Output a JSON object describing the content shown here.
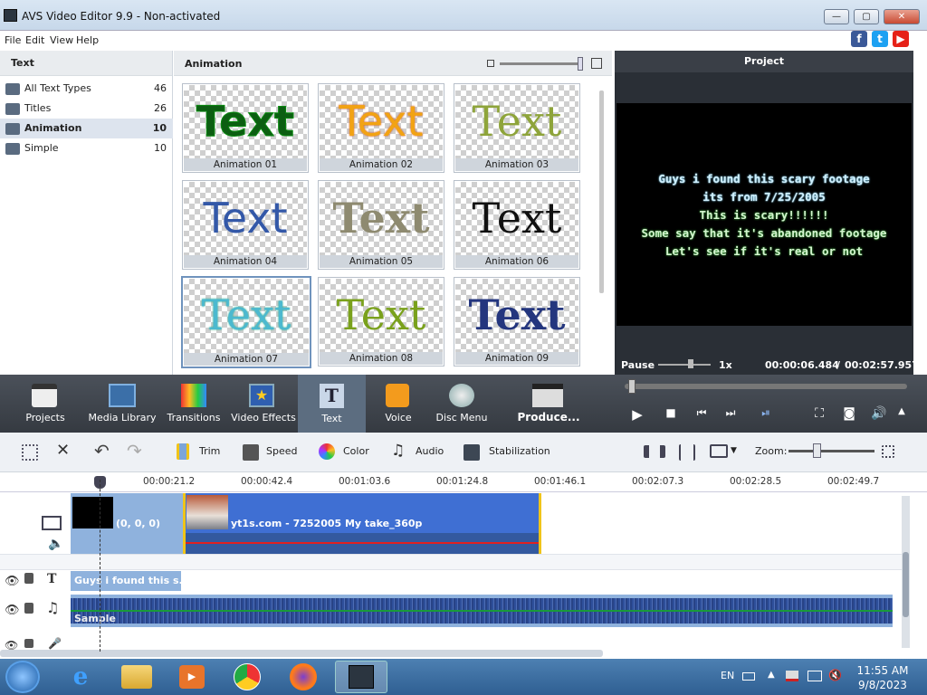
{
  "window": {
    "title": "AVS Video Editor 9.9 - Non-activated",
    "minimize": "—",
    "maximize": "▢",
    "close": "✕"
  },
  "menu": [
    "File",
    "Edit",
    "View",
    "Help"
  ],
  "social": {
    "facebook": "f",
    "twitter": "t",
    "youtube": "▶"
  },
  "text_panel": {
    "title": "Text",
    "types": [
      {
        "label": "All Text Types",
        "count": "46"
      },
      {
        "label": "Titles",
        "count": "26"
      },
      {
        "label": "Animation",
        "count": "10"
      },
      {
        "label": "Simple",
        "count": "10"
      }
    ]
  },
  "grid_panel": {
    "title": "Animation",
    "items": [
      {
        "label": "Animation 01",
        "sample": "Text"
      },
      {
        "label": "Animation 02",
        "sample": "Text"
      },
      {
        "label": "Animation 03",
        "sample": "Text"
      },
      {
        "label": "Animation 04",
        "sample": "Text"
      },
      {
        "label": "Animation 05",
        "sample": "Text"
      },
      {
        "label": "Animation 06",
        "sample": "Text"
      },
      {
        "label": "Animation 07",
        "sample": "Text"
      },
      {
        "label": "Animation 08",
        "sample": "Text"
      },
      {
        "label": "Animation 09",
        "sample": "Text"
      }
    ]
  },
  "preview": {
    "title": "Project",
    "captions": [
      "Guys i found this scary footage",
      "its from 7/25/2005",
      "This is scary!!!!!!",
      "Some say that it's abandoned footage",
      "Let's see if it's real or not"
    ],
    "state": "Pause",
    "speed": "1x",
    "current_time": "00:00:06.484",
    "separator": "/",
    "total_time": "00:02:57.957"
  },
  "main_toolbar": [
    {
      "label": "Projects"
    },
    {
      "label": "Media Library"
    },
    {
      "label": "Transitions"
    },
    {
      "label": "Video Effects"
    },
    {
      "label": "Text"
    },
    {
      "label": "Voice"
    },
    {
      "label": "Disc Menu"
    },
    {
      "label": "Produce..."
    }
  ],
  "edit_toolbar": {
    "trim": "Trim",
    "speed": "Speed",
    "color": "Color",
    "audio": "Audio",
    "stabilization": "Stabilization",
    "zoom": "Zoom:"
  },
  "ruler": [
    "00:00:21.2",
    "00:00:42.4",
    "00:01:03.6",
    "00:01:24.8",
    "00:01:46.1",
    "00:02:07.3",
    "00:02:28.5",
    "00:02:49.7"
  ],
  "timeline": {
    "clip1_label": "(0, 0, 0)",
    "clip2_label": "yt1s.com - 7252005 My take_360p",
    "text_clip": "Guys i found this s...",
    "audio_clip": "Sample"
  },
  "taskbar": {
    "lang": "EN",
    "time": "11:55 AM",
    "date": "9/8/2023"
  }
}
